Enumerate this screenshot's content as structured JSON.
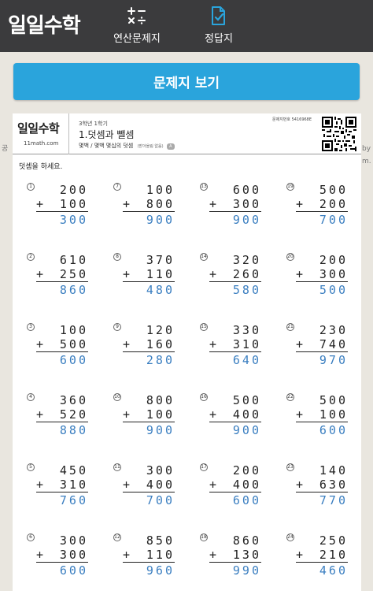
{
  "header": {
    "logo": "일일수학",
    "tabs": [
      {
        "label": "연산문제지",
        "icon": "math-operators-icon"
      },
      {
        "label": "정답지",
        "icon": "checked-document-icon"
      }
    ]
  },
  "view_button": {
    "label": "문제지 보기"
  },
  "edges": {
    "left": "공",
    "right": "by\nm."
  },
  "worksheet": {
    "brand": "일일수학",
    "url": "11math.com",
    "grade": "3학년 1학기",
    "title": "1.덧셈과 뺄셈",
    "subtitle": "몇백 / 몇백 몇십의 덧셈",
    "subtitle_note": "(받아올림 없음)",
    "subtitle_badge": "A",
    "code": "문제지번호 5416968E",
    "instruction": "덧셈을 하세요.",
    "problems": [
      {
        "no": "1",
        "a": "200",
        "op": "+",
        "b": "100",
        "ans": "300"
      },
      {
        "no": "7",
        "a": "100",
        "op": "+",
        "b": "800",
        "ans": "900"
      },
      {
        "no": "13",
        "a": "600",
        "op": "+",
        "b": "300",
        "ans": "900"
      },
      {
        "no": "19",
        "a": "500",
        "op": "+",
        "b": "200",
        "ans": "700"
      },
      {
        "no": "2",
        "a": "610",
        "op": "+",
        "b": "250",
        "ans": "860"
      },
      {
        "no": "8",
        "a": "370",
        "op": "+",
        "b": "110",
        "ans": "480"
      },
      {
        "no": "14",
        "a": "320",
        "op": "+",
        "b": "260",
        "ans": "580"
      },
      {
        "no": "20",
        "a": "200",
        "op": "+",
        "b": "300",
        "ans": "500"
      },
      {
        "no": "3",
        "a": "100",
        "op": "+",
        "b": "500",
        "ans": "600"
      },
      {
        "no": "9",
        "a": "120",
        "op": "+",
        "b": "160",
        "ans": "280"
      },
      {
        "no": "15",
        "a": "330",
        "op": "+",
        "b": "310",
        "ans": "640"
      },
      {
        "no": "21",
        "a": "230",
        "op": "+",
        "b": "740",
        "ans": "970"
      },
      {
        "no": "4",
        "a": "360",
        "op": "+",
        "b": "520",
        "ans": "880"
      },
      {
        "no": "10",
        "a": "800",
        "op": "+",
        "b": "100",
        "ans": "900"
      },
      {
        "no": "16",
        "a": "500",
        "op": "+",
        "b": "400",
        "ans": "900"
      },
      {
        "no": "22",
        "a": "500",
        "op": "+",
        "b": "100",
        "ans": "600"
      },
      {
        "no": "5",
        "a": "450",
        "op": "+",
        "b": "310",
        "ans": "760"
      },
      {
        "no": "11",
        "a": "300",
        "op": "+",
        "b": "400",
        "ans": "700"
      },
      {
        "no": "17",
        "a": "200",
        "op": "+",
        "b": "400",
        "ans": "600"
      },
      {
        "no": "23",
        "a": "140",
        "op": "+",
        "b": "630",
        "ans": "770"
      },
      {
        "no": "6",
        "a": "300",
        "op": "+",
        "b": "300",
        "ans": "600"
      },
      {
        "no": "12",
        "a": "850",
        "op": "+",
        "b": "110",
        "ans": "960"
      },
      {
        "no": "18",
        "a": "860",
        "op": "+",
        "b": "130",
        "ans": "990"
      },
      {
        "no": "24",
        "a": "250",
        "op": "+",
        "b": "210",
        "ans": "460"
      }
    ]
  },
  "colors": {
    "header_bg": "#3b3b3d",
    "button_bg": "#2aa4dc",
    "answer": "#3a7ec0",
    "page_bg": "#e9e6df"
  }
}
